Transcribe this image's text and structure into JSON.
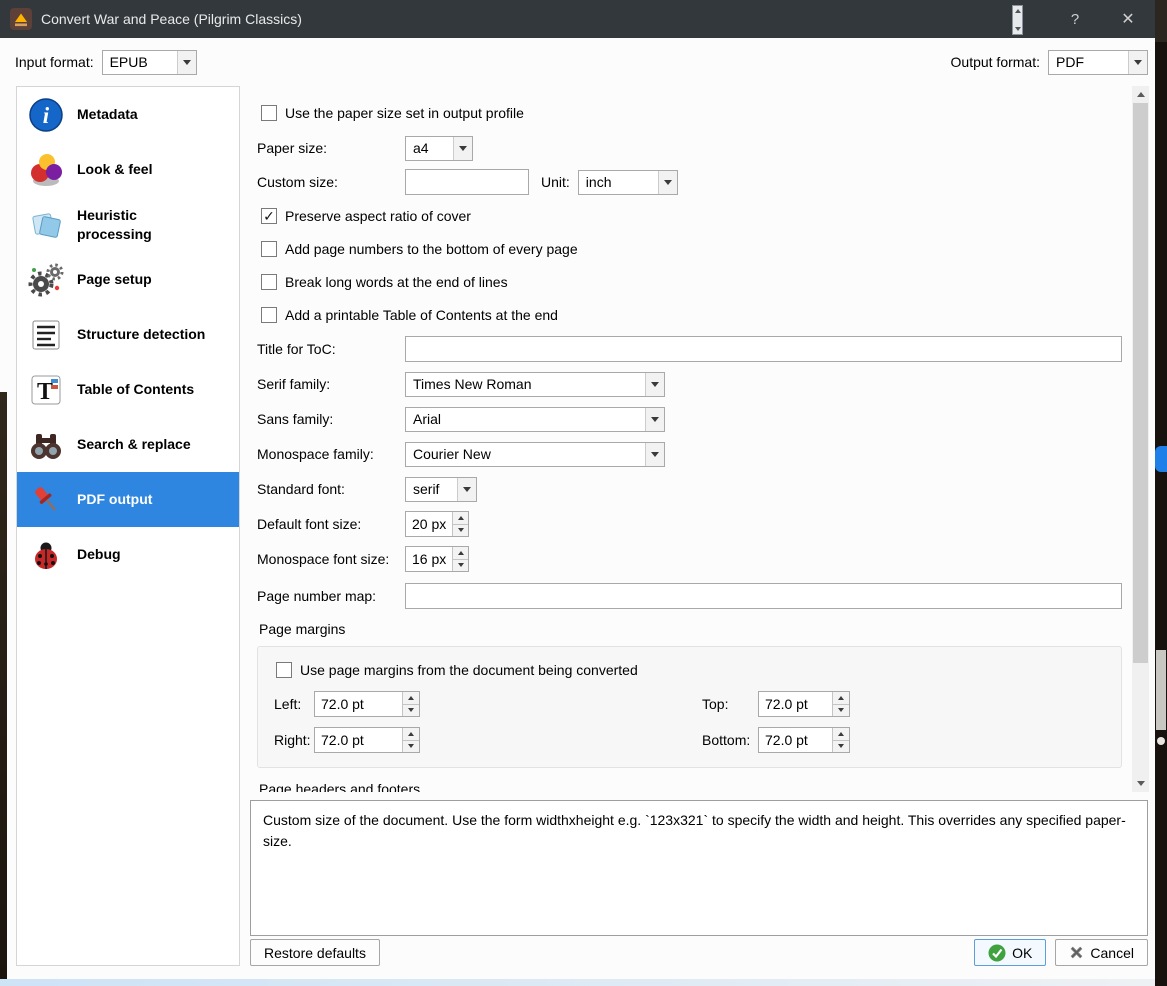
{
  "colors": {
    "titlebar_bg": "#33383d",
    "selection_blue": "#2e86e0",
    "ok_green": "#3fa23f",
    "window_bg": "#fcfcfc"
  },
  "titlebar": {
    "icon": "convert-book-icon",
    "title": "Convert War and Peace (Pilgrim Classics)",
    "help_label": "?",
    "close_label": "✕"
  },
  "format_bar": {
    "input_label": "Input format:",
    "input_value": "EPUB",
    "output_label": "Output format:",
    "output_value": "PDF"
  },
  "sidebar": {
    "items": [
      {
        "label": "Metadata",
        "icon": "metadata-info-icon",
        "selected": false
      },
      {
        "label": "Look & feel",
        "icon": "look-feel-icon",
        "selected": false
      },
      {
        "label": "Heuristic processing",
        "icon": "heuristic-processing-icon",
        "selected": false
      },
      {
        "label": "Page setup",
        "icon": "page-setup-gears-icon",
        "selected": false
      },
      {
        "label": "Structure detection",
        "icon": "structure-detection-icon",
        "selected": false
      },
      {
        "label": "Table of Contents",
        "icon": "table-of-contents-icon",
        "selected": false
      },
      {
        "label": "Search & replace",
        "icon": "search-replace-binoculars-icon",
        "selected": false
      },
      {
        "label": "PDF output",
        "icon": "pdf-output-pin-icon",
        "selected": true
      },
      {
        "label": "Debug",
        "icon": "debug-ladybug-icon",
        "selected": false
      }
    ]
  },
  "panel": {
    "use_paper_size": {
      "label": "Use the paper size set in output profile",
      "checked": false
    },
    "paper_size": {
      "label": "Paper size:",
      "value": "a4"
    },
    "custom_size": {
      "label": "Custom size:",
      "value": ""
    },
    "unit": {
      "label": "Unit:",
      "value": "inch"
    },
    "preserve_aspect": {
      "label": "Preserve aspect ratio of cover",
      "checked": true
    },
    "add_page_numbers": {
      "label": "Add page numbers to the bottom of every page",
      "checked": false
    },
    "break_long_words": {
      "label": "Break long words at the end of lines",
      "checked": false
    },
    "add_printable_toc": {
      "label": "Add a printable Table of Contents at the end",
      "checked": false
    },
    "toc_title": {
      "label": "Title for ToC:",
      "value": ""
    },
    "serif_family": {
      "label": "Serif family:",
      "value": "Times New Roman"
    },
    "sans_family": {
      "label": "Sans family:",
      "value": "Arial"
    },
    "monospace_family": {
      "label": "Monospace family:",
      "value": "Courier New"
    },
    "standard_font": {
      "label": "Standard font:",
      "value": "serif"
    },
    "default_font_size": {
      "label": "Default font size:",
      "value": "20 px"
    },
    "monospace_font_size": {
      "label": "Monospace font size:",
      "value": "16 px"
    },
    "page_number_map": {
      "label": "Page number map:",
      "value": ""
    },
    "page_margins": {
      "title": "Page margins",
      "use_doc_margins": {
        "label": "Use page margins from the document being converted",
        "checked": false
      },
      "left": {
        "label": "Left:",
        "value": "72.0 pt"
      },
      "top": {
        "label": "Top:",
        "value": "72.0 pt"
      },
      "right": {
        "label": "Right:",
        "value": "72.0 pt"
      },
      "bottom": {
        "label": "Bottom:",
        "value": "72.0 pt"
      }
    },
    "headers_footers_title": "Page headers and footers"
  },
  "help_box": {
    "text": "Custom size of the document. Use the form widthxheight e.g. `123x321` to specify the width and height. This overrides any specified paper-size."
  },
  "footer": {
    "restore_defaults_label": "Restore defaults",
    "ok_label": "OK",
    "cancel_label": "Cancel"
  }
}
